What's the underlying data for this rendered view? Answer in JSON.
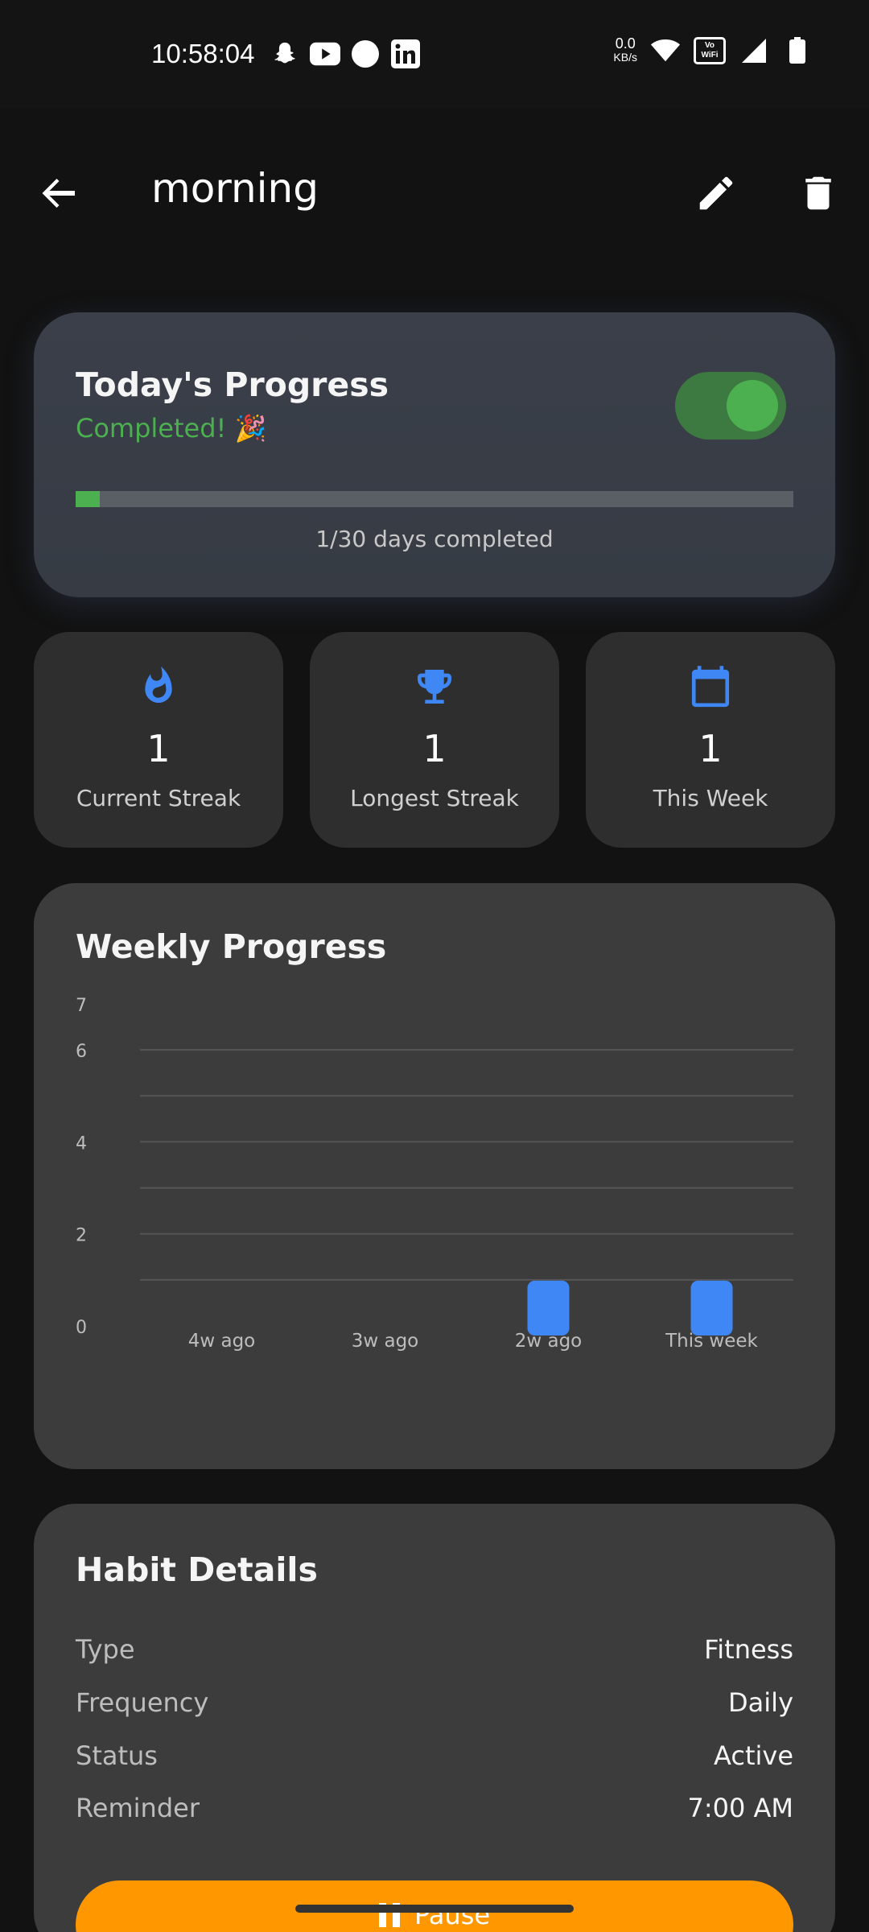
{
  "status_bar": {
    "time": "10:58:04",
    "net_speed": "0.0",
    "net_unit": "KB/s",
    "vowifi": "Vo WiFi",
    "notification_icons": [
      "snapchat-icon",
      "youtube-icon",
      "circle-icon",
      "linkedin-icon"
    ]
  },
  "app_bar": {
    "title": "morning"
  },
  "progress": {
    "title": "Today's Progress",
    "status": "Completed! 🎉",
    "toggle_on": true,
    "completed_days": 1,
    "total_days": 30,
    "fraction": 0.0333,
    "caption": "1/30 days completed"
  },
  "stats": [
    {
      "value": "1",
      "label": "Current Streak",
      "icon": "fire-icon"
    },
    {
      "value": "1",
      "label": "Longest Streak",
      "icon": "trophy-icon"
    },
    {
      "value": "1",
      "label": "This Week",
      "icon": "calendar-icon"
    }
  ],
  "colors": {
    "accent_blue": "#3f87f5",
    "success_green": "#4caf50",
    "pause_orange": "#ff9800"
  },
  "weekly": {
    "title": "Weekly Progress"
  },
  "chart_data": {
    "type": "bar",
    "categories": [
      "4w ago",
      "3w ago",
      "2w ago",
      "This week"
    ],
    "values": [
      0,
      0,
      1,
      1
    ],
    "ylim": [
      0,
      7
    ],
    "yticks": [
      "0",
      "2",
      "4",
      "6",
      "7"
    ],
    "grid": true
  },
  "details": {
    "title": "Habit Details",
    "rows": [
      {
        "key": "Type",
        "value": "Fitness"
      },
      {
        "key": "Frequency",
        "value": "Daily"
      },
      {
        "key": "Status",
        "value": "Active"
      },
      {
        "key": "Reminder",
        "value": "7:00 AM"
      }
    ],
    "pause_label": "Pause"
  }
}
